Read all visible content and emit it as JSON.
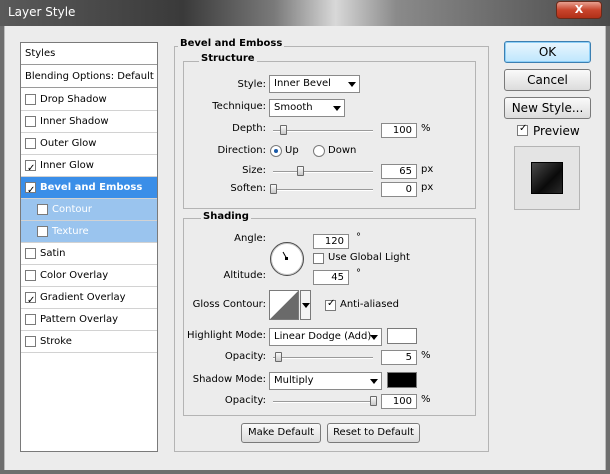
{
  "window": {
    "title": "Layer Style",
    "close_glyph": "X"
  },
  "styles_panel": {
    "header": "Styles",
    "blending": "Blending Options: Default",
    "items": [
      {
        "label": "Drop Shadow",
        "checked": false
      },
      {
        "label": "Inner Shadow",
        "checked": false
      },
      {
        "label": "Outer Glow",
        "checked": false
      },
      {
        "label": "Inner Glow",
        "checked": true
      },
      {
        "label": "Bevel and Emboss",
        "checked": true,
        "selected": true
      },
      {
        "label": "Contour",
        "checked": false,
        "sub": true
      },
      {
        "label": "Texture",
        "checked": false,
        "sub": true
      },
      {
        "label": "Satin",
        "checked": false
      },
      {
        "label": "Color Overlay",
        "checked": false
      },
      {
        "label": "Gradient Overlay",
        "checked": true
      },
      {
        "label": "Pattern Overlay",
        "checked": false
      },
      {
        "label": "Stroke",
        "checked": false
      }
    ]
  },
  "bevel": {
    "section_title": "Bevel and Emboss",
    "structure": {
      "title": "Structure",
      "style_label": "Style:",
      "style_value": "Inner Bevel",
      "technique_label": "Technique:",
      "technique_value": "Smooth",
      "depth_label": "Depth:",
      "depth_value": "100",
      "depth_unit": "%",
      "depth_level": 0.1,
      "direction_label": "Direction:",
      "direction_up": "Up",
      "direction_down": "Down",
      "direction_selected": "Up",
      "size_label": "Size:",
      "size_value": "65",
      "size_unit": "px",
      "size_level": 0.27,
      "soften_label": "Soften:",
      "soften_value": "0",
      "soften_unit": "px",
      "soften_level": 0
    },
    "shading": {
      "title": "Shading",
      "angle_label": "Angle:",
      "angle_value": "120",
      "angle_unit": "°",
      "use_global_light": "Use Global Light",
      "use_global_light_checked": false,
      "altitude_label": "Altitude:",
      "altitude_value": "45",
      "altitude_unit": "°",
      "gloss_contour_label": "Gloss Contour:",
      "anti_aliased": "Anti-aliased",
      "anti_aliased_checked": true,
      "highlight_mode_label": "Highlight Mode:",
      "highlight_mode_value": "Linear Dodge (Add)",
      "highlight_color": "#ffffff",
      "highlight_opacity_label": "Opacity:",
      "highlight_opacity_value": "5",
      "highlight_opacity_unit": "%",
      "highlight_opacity_level": 0.05,
      "shadow_mode_label": "Shadow Mode:",
      "shadow_mode_value": "Multiply",
      "shadow_color": "#000000",
      "shadow_opacity_label": "Opacity:",
      "shadow_opacity_value": "100",
      "shadow_opacity_unit": "%",
      "shadow_opacity_level": 1.0
    },
    "make_default": "Make Default",
    "reset_to_default": "Reset to Default"
  },
  "buttons": {
    "ok": "OK",
    "cancel": "Cancel",
    "new_style": "New Style...",
    "preview": "Preview",
    "preview_checked": true
  },
  "colors": {
    "selected_item": "#3a8ee8",
    "sub_item": "#9ac4ee",
    "close": "#c8442c"
  }
}
